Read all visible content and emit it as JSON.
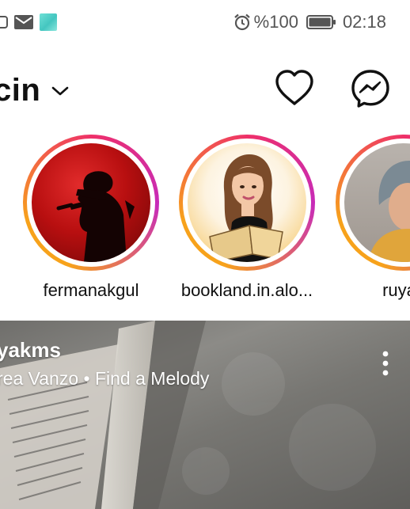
{
  "status_bar": {
    "left_icons": [
      "app-icon",
      "mail-icon",
      "thumbnail-icon"
    ],
    "alarm_icon": "alarm-icon",
    "battery_percent": "%100",
    "battery_icon": "battery-icon",
    "time": "02:18"
  },
  "header": {
    "title": "cin",
    "dropdown_icon": "chevron-down-icon",
    "activity_icon": "heart-icon",
    "messages_icon": "messenger-icon"
  },
  "stories": [
    {
      "username": "fermanakgul"
    },
    {
      "username": "bookland.in.alo..."
    },
    {
      "username": "ruyak"
    }
  ],
  "post": {
    "username": "yakms",
    "audio": "rea Vanzo • Find a Melody",
    "more_icon": "more-vertical-icon"
  },
  "colors": {
    "story_ring_orange": "#f7a21b",
    "story_ring_pink": "#ee2f6a",
    "story_ring_purple": "#c72bb9"
  }
}
